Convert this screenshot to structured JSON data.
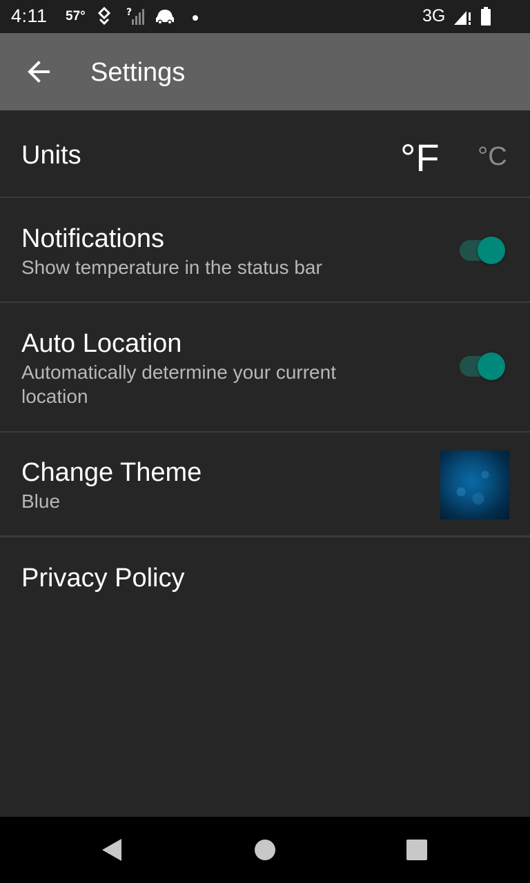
{
  "status_bar": {
    "time": "4:11",
    "temperature": "57°",
    "network": "3G",
    "icons": [
      "location-pin-icon",
      "signal-unknown-icon",
      "car-icon",
      "notification-dot-icon",
      "signal-icon",
      "battery-icon"
    ]
  },
  "app_bar": {
    "title": "Settings",
    "back_icon": "arrow-left-icon",
    "color": "#616161"
  },
  "settings": {
    "units": {
      "label": "Units",
      "fahrenheit": "°F",
      "celsius": "°C",
      "selected": "°F"
    },
    "notifications": {
      "label": "Notifications",
      "description": "Show temperature in the status bar",
      "enabled": true
    },
    "auto_location": {
      "label": "Auto Location",
      "description": "Automatically determine your current location",
      "enabled": true
    },
    "change_theme": {
      "label": "Change Theme",
      "value": "Blue"
    },
    "privacy_policy": {
      "label": "Privacy Policy"
    }
  },
  "colors": {
    "background": "#262626",
    "accent": "#00897b",
    "secondary_text": "#b8b8b8"
  },
  "nav_bar": {
    "icons": [
      "back-triangle-icon",
      "home-circle-icon",
      "recents-square-icon"
    ]
  }
}
